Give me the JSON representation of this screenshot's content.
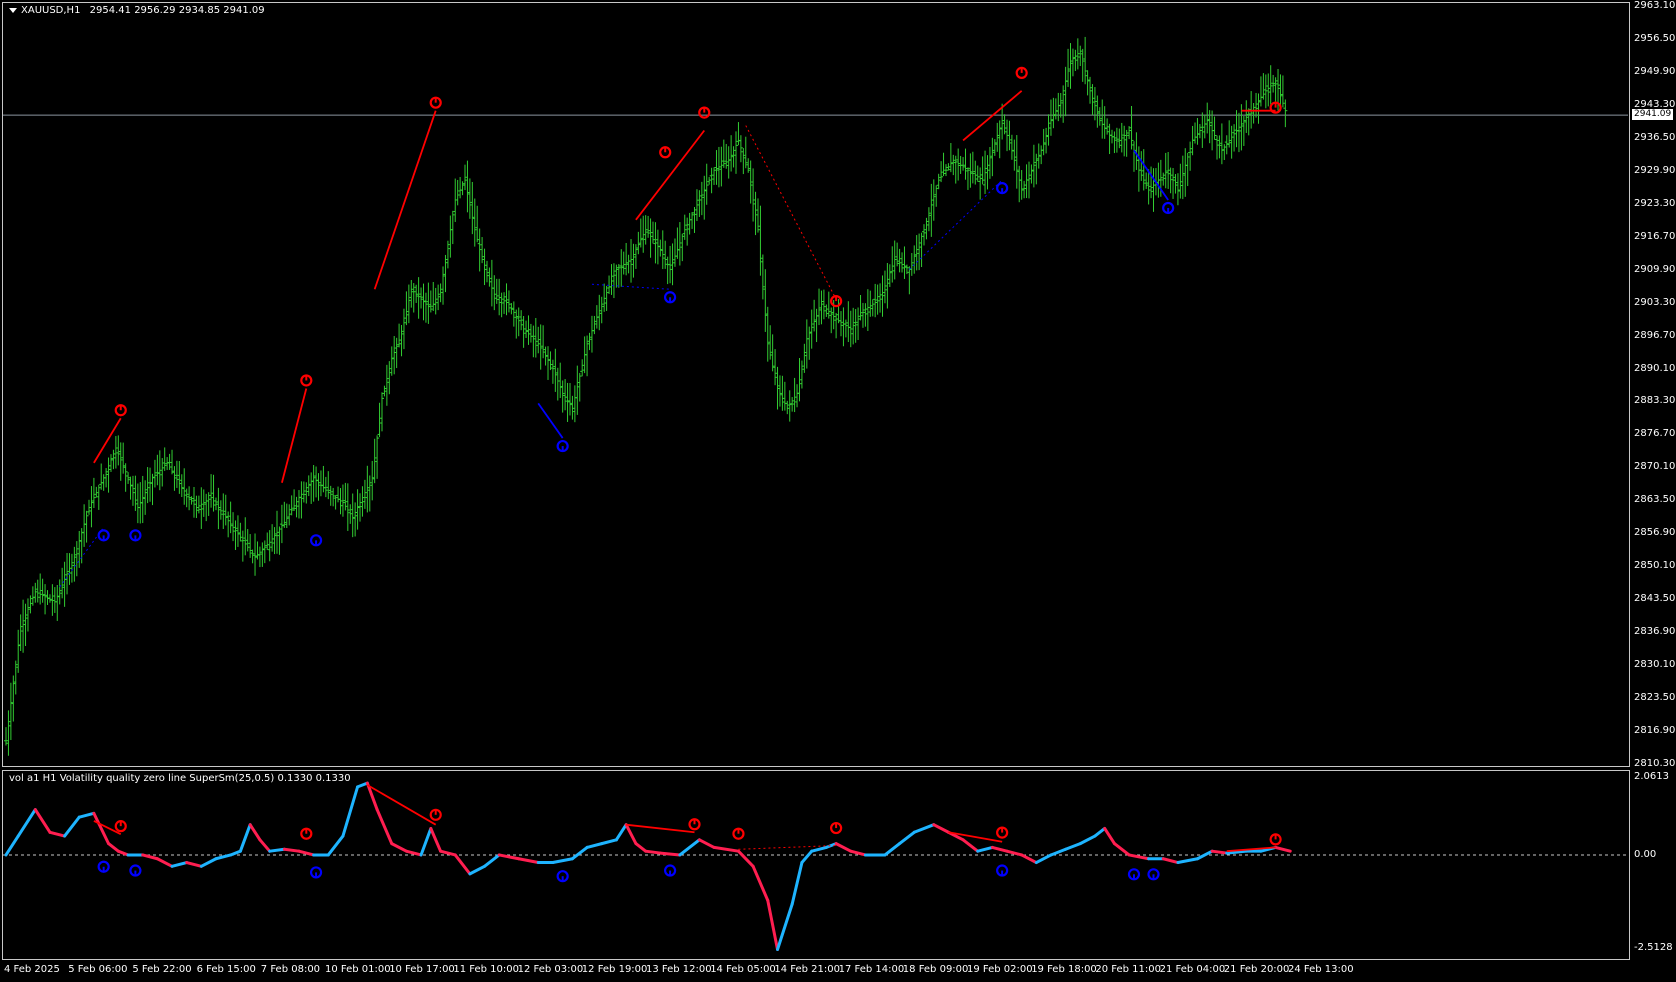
{
  "main_title": {
    "symbol": "XAUUSD,H1",
    "open": "2954.41",
    "high": "2956.29",
    "low": "2934.85",
    "close": "2941.09"
  },
  "indicator_title": "vol a1 H1 Volatility quality zero line SuperSm(25,0.5) 0.1330 0.1330",
  "price_axis": [
    "2963.10",
    "2956.50",
    "2949.90",
    "2943.30",
    "2936.50",
    "2929.90",
    "2923.30",
    "2916.70",
    "2909.90",
    "2903.30",
    "2896.70",
    "2890.10",
    "2883.30",
    "2876.70",
    "2870.10",
    "2863.50",
    "2856.90",
    "2850.10",
    "2843.50",
    "2836.90",
    "2830.10",
    "2823.50",
    "2816.90",
    "2810.30"
  ],
  "current_price_tag": "2941.09",
  "indicator_axis": {
    "top": "2.0613",
    "zero": "0.00",
    "bottom": "-2.5128"
  },
  "time_axis": [
    "4 Feb 2025",
    "5 Feb 06:00",
    "5 Feb 22:00",
    "6 Feb 15:00",
    "7 Feb 08:00",
    "10 Feb 01:00",
    "10 Feb 17:00",
    "11 Feb 10:00",
    "12 Feb 03:00",
    "12 Feb 19:00",
    "13 Feb 12:00",
    "14 Feb 05:00",
    "14 Feb 21:00",
    "17 Feb 14:00",
    "18 Feb 09:00",
    "19 Feb 02:00",
    "19 Feb 18:00",
    "20 Feb 11:00",
    "21 Feb 04:00",
    "21 Feb 20:00",
    "24 Feb 13:00"
  ],
  "colors": {
    "bars": "#32cd32",
    "up_arrow": "#ff0000",
    "down_arrow": "#0000ff",
    "ind_up": "#1eb4ff",
    "ind_down": "#ff1e50",
    "trend_red": "#ff0000",
    "trend_blue": "#0000ff",
    "grid_line": "#c8c8c8"
  },
  "chart_data": {
    "type": "candlestick",
    "symbol": "XAUUSD",
    "timeframe": "H1",
    "ylim": [
      2810.3,
      2963.1
    ],
    "current_price": 2941.09,
    "close_path": [
      [
        0,
        2815
      ],
      [
        6,
        2838
      ],
      [
        12,
        2845
      ],
      [
        20,
        2843
      ],
      [
        28,
        2852
      ],
      [
        34,
        2862
      ],
      [
        40,
        2868
      ],
      [
        45,
        2874
      ],
      [
        50,
        2868
      ],
      [
        54,
        2862
      ],
      [
        60,
        2868
      ],
      [
        66,
        2871
      ],
      [
        72,
        2866
      ],
      [
        78,
        2862
      ],
      [
        84,
        2864
      ],
      [
        90,
        2860
      ],
      [
        96,
        2856
      ],
      [
        102,
        2852
      ],
      [
        108,
        2855
      ],
      [
        114,
        2859
      ],
      [
        120,
        2864
      ],
      [
        126,
        2868
      ],
      [
        132,
        2865
      ],
      [
        138,
        2863
      ],
      [
        142,
        2860
      ],
      [
        146,
        2864
      ],
      [
        150,
        2868
      ],
      [
        154,
        2884
      ],
      [
        158,
        2892
      ],
      [
        162,
        2897
      ],
      [
        166,
        2906
      ],
      [
        170,
        2904
      ],
      [
        174,
        2902
      ],
      [
        178,
        2906
      ],
      [
        184,
        2924
      ],
      [
        188,
        2928
      ],
      [
        192,
        2918
      ],
      [
        196,
        2910
      ],
      [
        200,
        2905
      ],
      [
        206,
        2903
      ],
      [
        212,
        2898
      ],
      [
        218,
        2895
      ],
      [
        224,
        2890
      ],
      [
        228,
        2885
      ],
      [
        232,
        2882
      ],
      [
        238,
        2895
      ],
      [
        244,
        2903
      ],
      [
        250,
        2910
      ],
      [
        256,
        2912
      ],
      [
        262,
        2918
      ],
      [
        268,
        2914
      ],
      [
        272,
        2910
      ],
      [
        278,
        2918
      ],
      [
        284,
        2924
      ],
      [
        290,
        2930
      ],
      [
        296,
        2932
      ],
      [
        300,
        2936
      ],
      [
        304,
        2930
      ],
      [
        308,
        2918
      ],
      [
        312,
        2895
      ],
      [
        316,
        2886
      ],
      [
        320,
        2882
      ],
      [
        324,
        2885
      ],
      [
        328,
        2896
      ],
      [
        334,
        2903
      ],
      [
        340,
        2900
      ],
      [
        346,
        2898
      ],
      [
        352,
        2902
      ],
      [
        358,
        2904
      ],
      [
        364,
        2912
      ],
      [
        370,
        2910
      ],
      [
        376,
        2918
      ],
      [
        382,
        2928
      ],
      [
        388,
        2932
      ],
      [
        394,
        2930
      ],
      [
        400,
        2928
      ],
      [
        404,
        2934
      ],
      [
        408,
        2940
      ],
      [
        412,
        2934
      ],
      [
        416,
        2926
      ],
      [
        420,
        2930
      ],
      [
        424,
        2934
      ],
      [
        428,
        2940
      ],
      [
        432,
        2944
      ],
      [
        436,
        2952
      ],
      [
        440,
        2954
      ],
      [
        444,
        2946
      ],
      [
        448,
        2940
      ],
      [
        452,
        2937
      ],
      [
        456,
        2936
      ],
      [
        460,
        2938
      ],
      [
        464,
        2930
      ],
      [
        468,
        2926
      ],
      [
        472,
        2928
      ],
      [
        476,
        2930
      ],
      [
        480,
        2926
      ],
      [
        486,
        2936
      ],
      [
        492,
        2940
      ],
      [
        498,
        2934
      ],
      [
        504,
        2938
      ],
      [
        510,
        2942
      ],
      [
        516,
        2946
      ],
      [
        520,
        2948
      ],
      [
        524,
        2942
      ]
    ],
    "up_arrows": [
      [
        47,
        2880
      ],
      [
        123,
        2886
      ],
      [
        176,
        2942
      ],
      [
        270,
        2932
      ],
      [
        286,
        2940
      ],
      [
        340,
        2902
      ],
      [
        416,
        2948
      ],
      [
        520,
        2941
      ]
    ],
    "down_arrows": [
      [
        40,
        2858
      ],
      [
        53,
        2858
      ],
      [
        127,
        2857
      ],
      [
        228,
        2876
      ],
      [
        272,
        2906
      ],
      [
        408,
        2928
      ],
      [
        476,
        2924
      ]
    ],
    "red_trend_solid": [
      [
        [
          36,
          2871
        ],
        [
          47,
          2880
        ]
      ],
      [
        [
          113,
          2867
        ],
        [
          123,
          2886
        ]
      ],
      [
        [
          151,
          2906
        ],
        [
          176,
          2942
        ]
      ],
      [
        [
          258,
          2920
        ],
        [
          286,
          2938
        ]
      ],
      [
        [
          392,
          2936
        ],
        [
          416,
          2946
        ]
      ],
      [
        [
          506,
          2942
        ],
        [
          520,
          2942
        ]
      ]
    ],
    "red_trend_dotted": [
      [
        [
          303,
          2939
        ],
        [
          340,
          2904
        ]
      ]
    ],
    "blue_trend_solid": [
      [
        [
          218,
          2883
        ],
        [
          228,
          2876
        ]
      ],
      [
        [
          462,
          2934
        ],
        [
          476,
          2924
        ]
      ]
    ],
    "blue_trend_dotted": [
      [
        [
          22,
          2846
        ],
        [
          40,
          2858
        ]
      ],
      [
        [
          240,
          2907
        ],
        [
          272,
          2906
        ]
      ],
      [
        [
          370,
          2910
        ],
        [
          408,
          2928
        ]
      ]
    ]
  },
  "indicator_data": {
    "ylim": [
      -2.5128,
      2.0613
    ],
    "series": [
      [
        0,
        0.0
      ],
      [
        5,
        0.5
      ],
      [
        12,
        1.2
      ],
      [
        18,
        0.6
      ],
      [
        24,
        0.5
      ],
      [
        30,
        1.0
      ],
      [
        36,
        1.1
      ],
      [
        42,
        0.3
      ],
      [
        46,
        0.1
      ],
      [
        50,
        0.0
      ],
      [
        56,
        0.0
      ],
      [
        62,
        -0.1
      ],
      [
        68,
        -0.3
      ],
      [
        74,
        -0.2
      ],
      [
        80,
        -0.3
      ],
      [
        86,
        -0.1
      ],
      [
        92,
        0.0
      ],
      [
        96,
        0.1
      ],
      [
        100,
        0.8
      ],
      [
        104,
        0.4
      ],
      [
        108,
        0.1
      ],
      [
        114,
        0.15
      ],
      [
        120,
        0.1
      ],
      [
        126,
        0.0
      ],
      [
        132,
        0.0
      ],
      [
        138,
        0.5
      ],
      [
        144,
        1.8
      ],
      [
        148,
        1.9
      ],
      [
        152,
        1.2
      ],
      [
        158,
        0.3
      ],
      [
        164,
        0.1
      ],
      [
        170,
        0.0
      ],
      [
        174,
        0.7
      ],
      [
        178,
        0.1
      ],
      [
        184,
        0.0
      ],
      [
        190,
        -0.5
      ],
      [
        196,
        -0.3
      ],
      [
        202,
        0.0
      ],
      [
        210,
        -0.1
      ],
      [
        218,
        -0.2
      ],
      [
        224,
        -0.2
      ],
      [
        232,
        -0.1
      ],
      [
        238,
        0.2
      ],
      [
        244,
        0.3
      ],
      [
        250,
        0.4
      ],
      [
        254,
        0.8
      ],
      [
        258,
        0.3
      ],
      [
        262,
        0.1
      ],
      [
        268,
        0.05
      ],
      [
        276,
        0.0
      ],
      [
        284,
        0.4
      ],
      [
        290,
        0.2
      ],
      [
        300,
        0.1
      ],
      [
        306,
        -0.3
      ],
      [
        312,
        -1.2
      ],
      [
        316,
        -2.5
      ],
      [
        322,
        -1.3
      ],
      [
        326,
        -0.2
      ],
      [
        330,
        0.1
      ],
      [
        336,
        0.2
      ],
      [
        340,
        0.3
      ],
      [
        346,
        0.1
      ],
      [
        352,
        0.0
      ],
      [
        360,
        0.0
      ],
      [
        366,
        0.3
      ],
      [
        372,
        0.6
      ],
      [
        380,
        0.8
      ],
      [
        386,
        0.6
      ],
      [
        392,
        0.4
      ],
      [
        398,
        0.1
      ],
      [
        404,
        0.2
      ],
      [
        410,
        0.1
      ],
      [
        416,
        0.0
      ],
      [
        422,
        -0.2
      ],
      [
        428,
        0.0
      ],
      [
        434,
        0.15
      ],
      [
        440,
        0.3
      ],
      [
        446,
        0.5
      ],
      [
        450,
        0.7
      ],
      [
        454,
        0.3
      ],
      [
        460,
        0.0
      ],
      [
        468,
        -0.1
      ],
      [
        474,
        -0.1
      ],
      [
        480,
        -0.2
      ],
      [
        488,
        -0.1
      ],
      [
        494,
        0.1
      ],
      [
        500,
        0.05
      ],
      [
        508,
        0.1
      ],
      [
        514,
        0.1
      ],
      [
        520,
        0.2
      ],
      [
        526,
        0.1
      ]
    ],
    "up_arrows": [
      [
        47,
        0.55
      ],
      [
        123,
        0.35
      ],
      [
        176,
        0.85
      ],
      [
        282,
        0.6
      ],
      [
        300,
        0.35
      ],
      [
        340,
        0.5
      ],
      [
        408,
        0.38
      ],
      [
        520,
        0.2
      ]
    ],
    "down_arrows": [
      [
        40,
        -0.1
      ],
      [
        53,
        -0.2
      ],
      [
        127,
        -0.25
      ],
      [
        228,
        -0.35
      ],
      [
        272,
        -0.2
      ],
      [
        408,
        -0.2
      ],
      [
        462,
        -0.3
      ],
      [
        470,
        -0.3
      ]
    ],
    "red_trend_solid": [
      [
        [
          36,
          0.9
        ],
        [
          47,
          0.55
        ]
      ],
      [
        [
          148,
          1.85
        ],
        [
          176,
          0.8
        ]
      ],
      [
        [
          254,
          0.8
        ],
        [
          282,
          0.6
        ]
      ],
      [
        [
          386,
          0.6
        ],
        [
          408,
          0.35
        ]
      ],
      [
        [
          500,
          0.1
        ],
        [
          520,
          0.2
        ]
      ]
    ],
    "red_trend_dotted": [
      [
        [
          300,
          0.15
        ],
        [
          340,
          0.25
        ]
      ]
    ]
  }
}
